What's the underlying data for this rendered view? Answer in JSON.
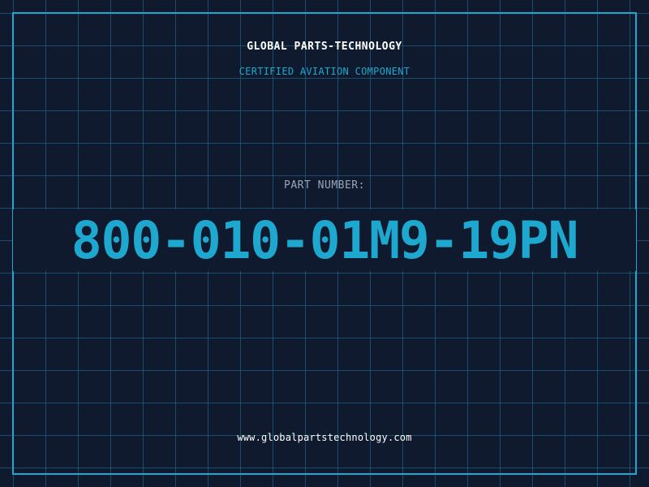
{
  "header": {
    "company": "GLOBAL PARTS-TECHNOLOGY",
    "tagline": "CERTIFIED AVIATION COMPONENT"
  },
  "part": {
    "label": "PART NUMBER:",
    "number": "800-010-01M9-19PN"
  },
  "footer": {
    "website": "www.globalpartstechnology.com"
  },
  "colors": {
    "background": "#101a2e",
    "accent": "#1ea8cf",
    "grid": "#227896",
    "text": "#ffffff",
    "muted": "#9aa6b8"
  }
}
